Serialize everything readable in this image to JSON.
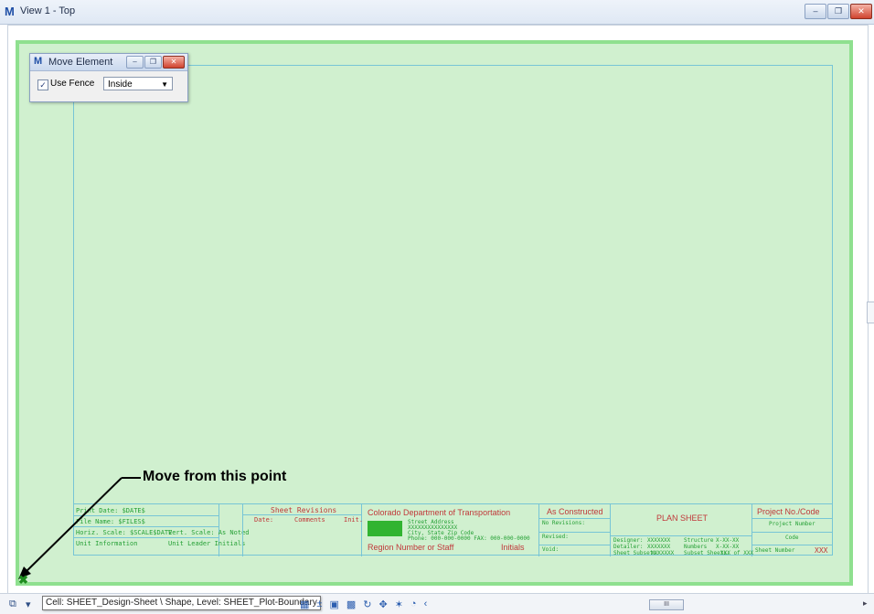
{
  "window": {
    "title": "View 1 - Top"
  },
  "dialog": {
    "title": "Move Element",
    "use_fence_label": "Use Fence",
    "use_fence_checked": true,
    "fence_mode": "Inside"
  },
  "annotation": {
    "text": "Move from this point"
  },
  "title_block": {
    "sheet_revisions": "Sheet Revisions",
    "rev_date": "Date:",
    "rev_comments": "Comments",
    "rev_init": "Init.",
    "left_lines": [
      "Print Date: $DATE$",
      "File Name: $FILES$",
      "Horiz. Scale: $SCALE$DATE",
      "Unit Information"
    ],
    "left_lines_b": [
      "",
      "",
      "Vert. Scale: As Noted",
      "Unit Leader Initials"
    ],
    "cdot": "Colorado Department of Transportation",
    "address": [
      "Street Address",
      "XXXXXXXXXXXXXXX",
      "City, State Zip Code",
      "Phone: 000-000-0000  FAX: 000-000-0000"
    ],
    "region": "Region Number or Staff",
    "initials": "Initials",
    "as_constructed": "As Constructed",
    "no_revisions": "No Revisions:",
    "revised": "Revised:",
    "void": "Void:",
    "plan_sheet": "PLAN SHEET",
    "designer": "Designer:",
    "designer_val": "XXXXXXX",
    "structure": "Structure",
    "structure_val": "X-XX-XX",
    "detailer": "Detailer:",
    "detailer_val": "XXXXXXX",
    "numbers": "Numbers",
    "numbers_val": "X-XX-XX",
    "subset": "Sheet Subsets:",
    "subset_val": "XXXXXXX",
    "subset_sheets": "Subset Sheets:",
    "subset_sheets_val": "XXX of XXX",
    "project_code": "Project No./Code",
    "project_number": "Project Number",
    "code": "Code",
    "sheet_number": "Sheet Number",
    "sheet_number_val": "XXX"
  },
  "statusbar": {
    "tooltip": "Cell: SHEET_Design-Sheet \\ Shape, Level: SHEET_Plot-Boundary",
    "scroll_label": "III"
  }
}
